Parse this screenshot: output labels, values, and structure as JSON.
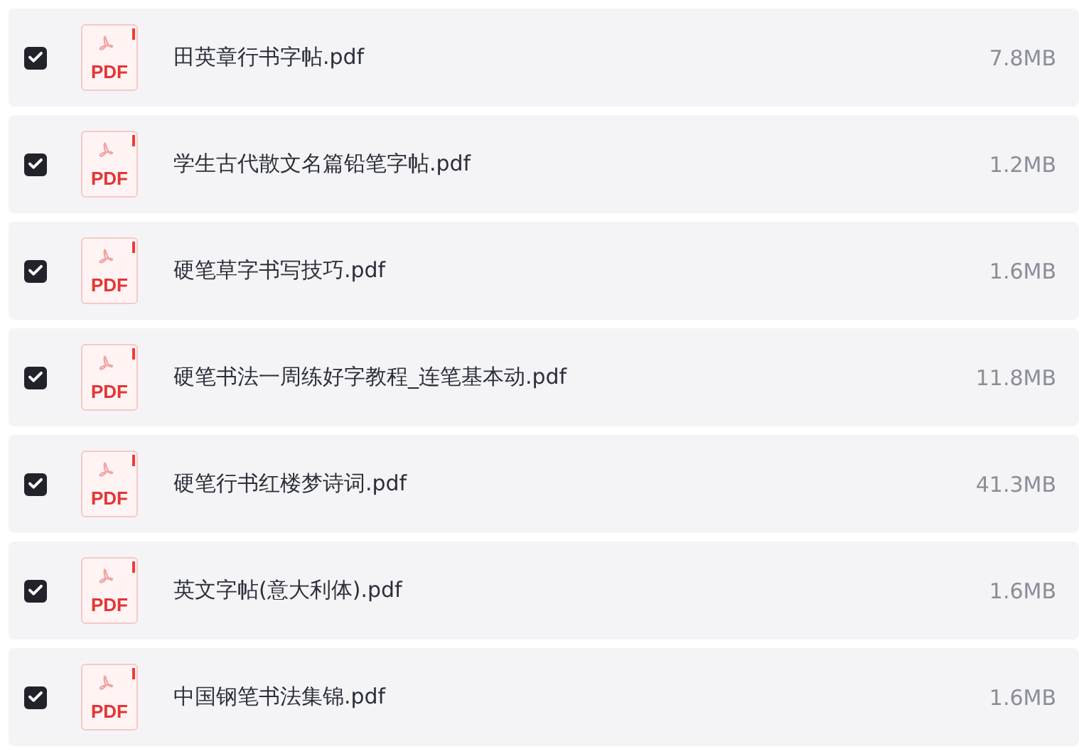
{
  "files": [
    {
      "checked": true,
      "icon_label": "PDF",
      "name": "田英章行书字帖.pdf",
      "size": "7.8MB"
    },
    {
      "checked": true,
      "icon_label": "PDF",
      "name": "学生古代散文名篇铅笔字帖.pdf",
      "size": "1.2MB"
    },
    {
      "checked": true,
      "icon_label": "PDF",
      "name": "硬笔草字书写技巧.pdf",
      "size": "1.6MB"
    },
    {
      "checked": true,
      "icon_label": "PDF",
      "name": "硬笔书法一周练好字教程_连笔基本动.pdf",
      "size": "11.8MB"
    },
    {
      "checked": true,
      "icon_label": "PDF",
      "name": "硬笔行书红楼梦诗词.pdf",
      "size": "41.3MB"
    },
    {
      "checked": true,
      "icon_label": "PDF",
      "name": "英文字帖(意大利体).pdf",
      "size": "1.6MB"
    },
    {
      "checked": true,
      "icon_label": "PDF",
      "name": "中国钢笔书法集锦.pdf",
      "size": "1.6MB"
    }
  ]
}
